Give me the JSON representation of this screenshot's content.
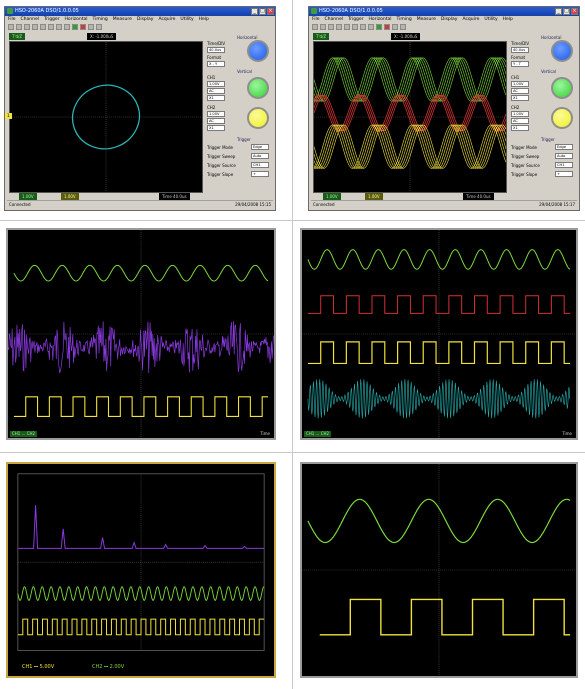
{
  "app": {
    "title": "HSO-2060A DSO/1.0.0.05",
    "menu": [
      "File",
      "Channel",
      "Trigger",
      "Horizontal",
      "Timing",
      "Measure",
      "Display",
      "Acquire",
      "Utility",
      "Help"
    ]
  },
  "panel1": {
    "mode_label": "T'd/Z",
    "cursor_label": "X: -1.000uS",
    "side": {
      "horizontal_title": "Horizontal",
      "time_div_label": "Time/DIV",
      "time_div_value": "40.0us",
      "format_label": "Format",
      "format_value": "X - Y",
      "vertical_title": "Vertical",
      "ch1_label": "CH1",
      "ch1_volts": "1.00V",
      "ch1_coupling": "AC",
      "ch1_probe": "X1",
      "ch2_label": "CH2",
      "ch2_volts": "1.00V",
      "ch2_coupling": "AC",
      "ch2_probe": "X1",
      "trigger_title": "Trigger",
      "trigger_mode_label": "Trigger Mode",
      "trigger_mode_value": "Edge",
      "trigger_sweep_label": "Trigger Sweep",
      "trigger_sweep_value": "Auto",
      "trigger_source_label": "Trigger Source",
      "trigger_source_value": "CH1",
      "trigger_slope_label": "Trigger Slope",
      "trigger_slope_value": "+"
    },
    "bottom": {
      "ch1": "1.00V",
      "ch2": "1.00V",
      "time": "Time 40.0us"
    },
    "status_left": "Connected",
    "status_right": "29/04/2008  15:15"
  },
  "panel2": {
    "mode_label": "T'd/Z",
    "cursor_label": "X: -1.000uS",
    "side": {
      "horizontal_title": "Horizontal",
      "time_div_label": "Time/DIV",
      "time_div_value": "40.0us",
      "format_label": "Format",
      "format_value": "Y - T",
      "vertical_title": "Vertical",
      "ch1_label": "CH1",
      "ch1_volts": "1.00V",
      "ch1_coupling": "AC",
      "ch1_probe": "X1",
      "ch2_label": "CH2",
      "ch2_volts": "1.00V",
      "ch2_coupling": "AC",
      "ch2_probe": "X1",
      "trigger_title": "Trigger",
      "trigger_mode_label": "Trigger Mode",
      "trigger_mode_value": "Edge",
      "trigger_sweep_label": "Trigger Sweep",
      "trigger_sweep_value": "Auto",
      "trigger_source_label": "Trigger Source",
      "trigger_source_value": "CH1",
      "trigger_slope_label": "Trigger Slope",
      "trigger_slope_value": "+"
    },
    "bottom": {
      "ch1": "1.00V",
      "ch2": "1.00V",
      "time": "Time 40.0us"
    },
    "status_left": "Connected",
    "status_right": "29/04/2008  15:17"
  },
  "panel3": {
    "bottom_left": "CH1 ... CH2",
    "bottom_right": "Time"
  },
  "panel4": {
    "bottom_left": "CH1 ... CH2",
    "bottom_right": "Time"
  },
  "panel5": {
    "ch1": "CH1 ⎓ 5.00V",
    "ch2": "CH2 ⎓ 2.00V"
  },
  "panel6": {},
  "colors": {
    "green": "#7ddc3a",
    "yellow": "#f2e33c",
    "cyan": "#28b0b0",
    "red": "#d23232",
    "purple": "#8a3ae0",
    "knob_blue": "#1e5ae6",
    "knob_green": "#32d232",
    "knob_yellow": "#f0f01e"
  }
}
